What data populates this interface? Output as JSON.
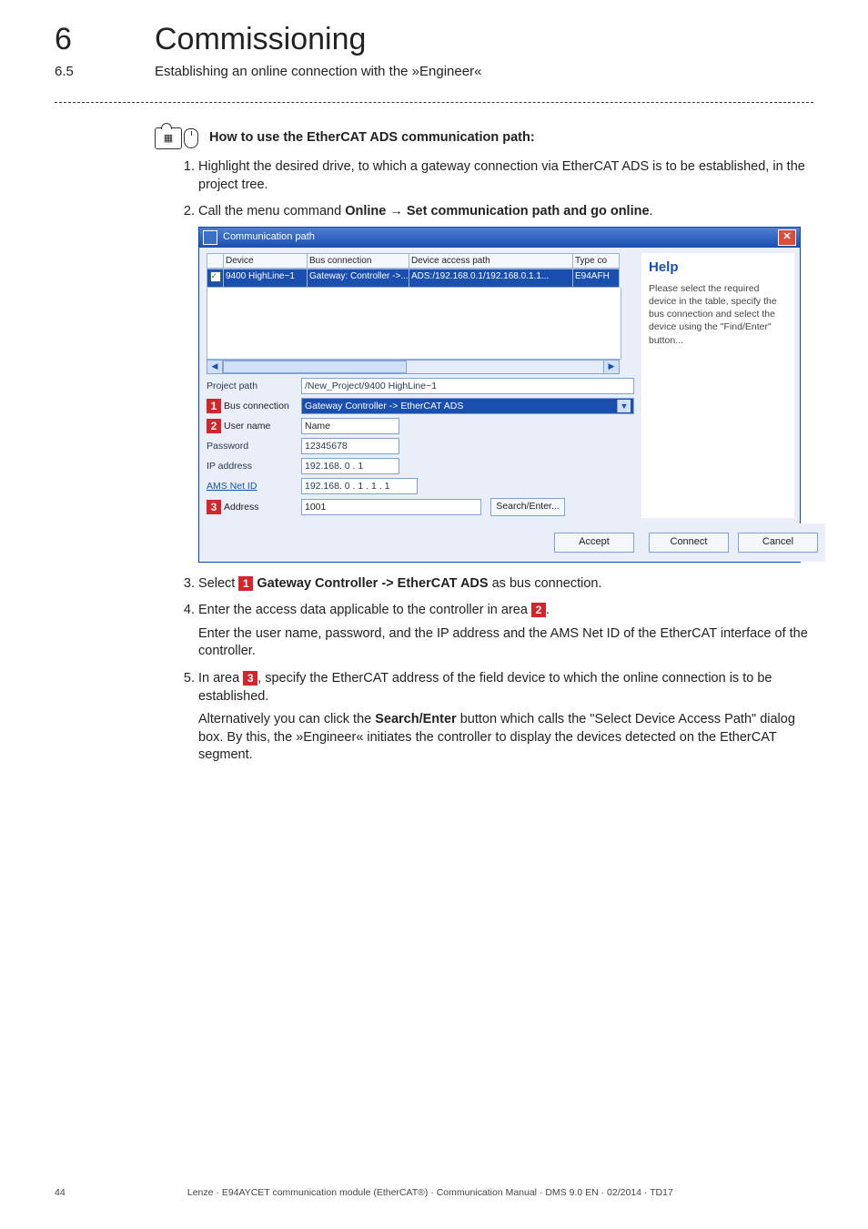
{
  "header": {
    "chapter_num": "6",
    "chapter_title": "Commissioning",
    "sub_num": "6.5",
    "sub_title": "Establishing an online connection with the »Engineer«"
  },
  "howto_title": "How to use the EtherCAT ADS communication path:",
  "steps": {
    "s1": "Highlight the desired drive, to which a gateway connection via EtherCAT ADS is to be established, in the project tree.",
    "s2_pre": "Call the menu command ",
    "s2_b1": "Online",
    "s2_arrow": " → ",
    "s2_b2": "Set communication path and go online",
    "s2_post": ".",
    "s3_pre": "Select ",
    "s3_bold": " Gateway Controller -> EtherCAT ADS",
    "s3_post": " as bus connection.",
    "s4_pre": "Enter the access data applicable to the controller in area ",
    "s4_post": ".",
    "s4_para": "Enter the user name, password, and the IP address and the AMS Net ID of the EtherCAT interface of the controller.",
    "s5_pre": "In area ",
    "s5_mid": ", specify the EtherCAT address of the field device to which the online connection is to be established.",
    "s5_para_pre": "Alternatively you can click the ",
    "s5_para_bold": "Search/Enter",
    "s5_para_post": " button which calls the \"Select Device Access Path\" dialog box. By this, the »Engineer« initiates the controller to display the devices detected on the EtherCAT segment."
  },
  "dialog": {
    "title": "Communication path",
    "grid_head": {
      "c1": "",
      "c2": "Device",
      "c3": "Bus connection",
      "c4": "Device access path",
      "c5": "Type co"
    },
    "grid_row": {
      "c2": "9400 HighLine~1",
      "c3": "Gateway: Controller ->...",
      "c4": "ADS:/192.168.0.1/192.168.0.1.1...",
      "c5": "E94AFH"
    },
    "help_hdr": "Help",
    "help_body": "Please select the required device in the table, specify the bus connection and select the device using the \"Find/Enter\" button...",
    "labels": {
      "project_path": "Project path",
      "bus_connection": "Bus connection",
      "user_name": "User name",
      "password": "Password",
      "ip_address": "IP address",
      "ams_net_id": "AMS Net ID",
      "address": "Address"
    },
    "values": {
      "project_path": "/New_Project/9400 HighLine~1",
      "bus_connection": "Gateway Controller -> EtherCAT ADS",
      "user_name": "Name",
      "password": "12345678",
      "ip_address": "192.168. 0 . 1",
      "ams_net_id": "192.168. 0 . 1 . 1 . 1",
      "address": "1001"
    },
    "buttons": {
      "search_enter": "Search/Enter...",
      "accept": "Accept",
      "connect": "Connect",
      "cancel": "Cancel"
    }
  },
  "markers": {
    "m1": "1",
    "m2": "2",
    "m3": "3"
  },
  "footer": {
    "page": "44",
    "text": "Lenze · E94AYCET communication module (EtherCAT®) · Communication Manual · DMS 9.0 EN · 02/2014 · TD17"
  }
}
